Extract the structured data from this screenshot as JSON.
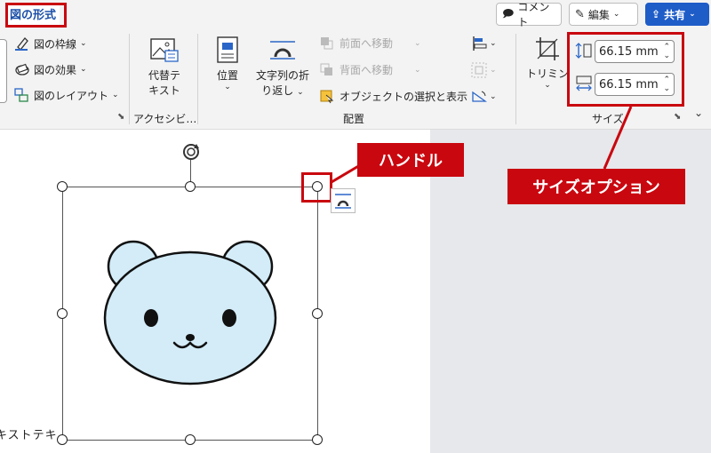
{
  "tab": {
    "title": "図の形式"
  },
  "topbar": {
    "comment_label": "コメント",
    "edit_label": "編集",
    "share_label": "共有"
  },
  "ribbon": {
    "border_label": "図の枠線",
    "effects_label": "図の効果",
    "layout_label": "図のレイアウト",
    "alt_text_line1": "代替テ",
    "alt_text_line2": "キスト",
    "accessibility_group": "アクセシビ…",
    "position_label": "位置",
    "wrap_line1": "文字列の折",
    "wrap_line2": "り返し",
    "bring_forward_label": "前面へ移動",
    "send_backward_label": "背面へ移動",
    "selection_pane_label": "オブジェクトの選択と表示",
    "arrange_group": "配置",
    "crop_label": "トリミング",
    "height_value": "66.15 mm",
    "width_value": "66.15 mm",
    "size_group": "サイズ"
  },
  "document": {
    "body_text": "キストテキ"
  },
  "annotations": {
    "handle_label": "ハンドル",
    "size_options_label": "サイズオプション"
  },
  "colors": {
    "accent": "#c9070f",
    "share_blue": "#1e5cc8",
    "bear_fill": "#d3ecf8"
  }
}
